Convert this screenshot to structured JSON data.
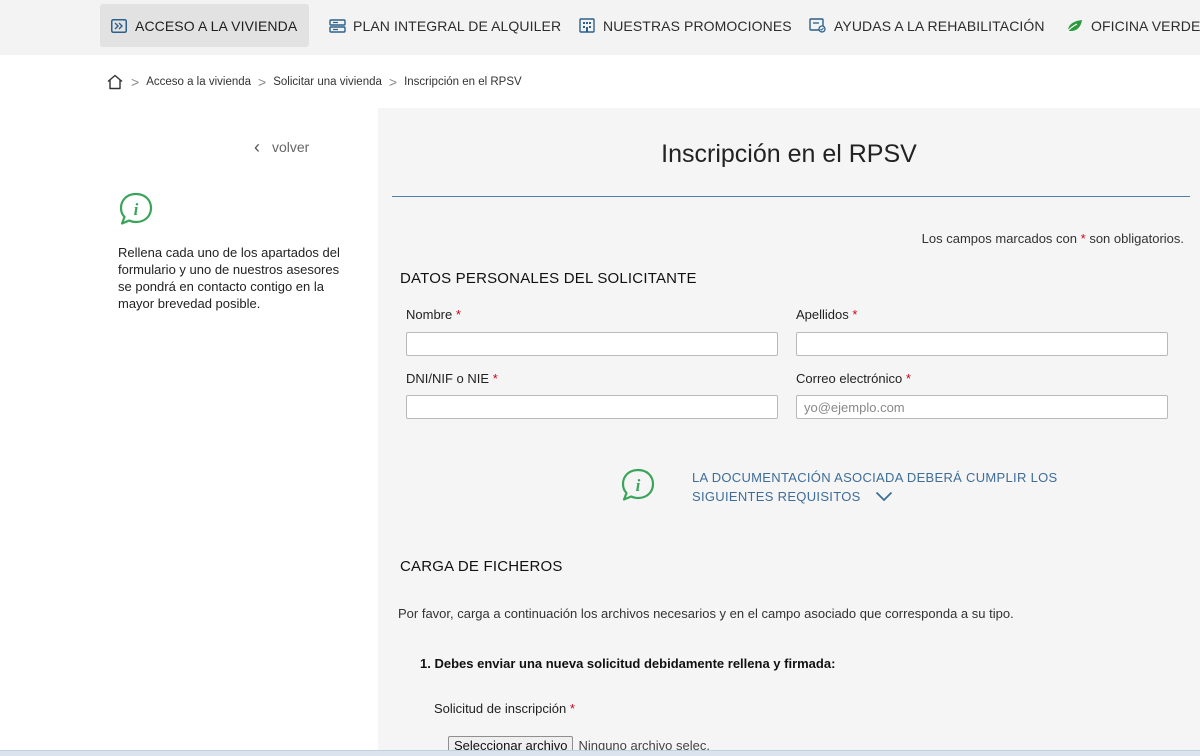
{
  "nav": {
    "items": [
      {
        "label": "ACCESO A LA VIVIENDA",
        "icon": "enter-icon"
      },
      {
        "label": "PLAN INTEGRAL DE ALQUILER",
        "icon": "cards-icon"
      },
      {
        "label": "NUESTRAS PROMOCIONES",
        "icon": "building-icon"
      },
      {
        "label": "AYUDAS A LA REHABILITACIÓN",
        "icon": "renovation-icon"
      },
      {
        "label": "OFICINA VERDE",
        "icon": "leaf-icon"
      }
    ],
    "active_index": 0
  },
  "breadcrumb": {
    "home_icon": "home-icon",
    "items": [
      "Acceso a la vivienda",
      "Solicitar una vivienda",
      "Inscripción en el RPSV"
    ]
  },
  "sidebar": {
    "back_label": "volver",
    "info_text": "Rellena cada uno de los apartados del formulario y uno de nuestros asesores se pondrá en contacto contigo en la mayor brevedad posible."
  },
  "main": {
    "title": "Inscripción en el RPSV",
    "required_note_prefix": "Los campos marcados con",
    "required_note_suffix": "son obligatorios.",
    "personal_section": "DATOS PERSONALES DEL SOLICITANTE",
    "fields": {
      "nombre": {
        "label": "Nombre",
        "value": ""
      },
      "apellidos": {
        "label": "Apellidos",
        "value": ""
      },
      "dni": {
        "label": "DNI/NIF o NIE",
        "value": ""
      },
      "email": {
        "label": "Correo electrónico",
        "placeholder": "yo@ejemplo.com",
        "value": ""
      }
    },
    "doc_info": "LA DOCUMENTACIÓN ASOCIADA DEBERÁ CUMPLIR LOS SIGUIENTES REQUISITOS",
    "files_section": "CARGA DE FICHEROS",
    "files_intro": "Por favor, carga a continuación los archivos necesarios y en el campo asociado que corresponda a su tipo.",
    "step1": "1. Debes enviar una nueva solicitud debidamente rellena y firmada:",
    "upload_label": "Solicitud de inscripción",
    "file_button": "Seleccionar archivo",
    "file_status": "Ninguno archivo selec."
  },
  "colors": {
    "accent": "#4f7ea7",
    "info_green": "#3aa55a",
    "required": "#d0021b",
    "link_blue": "#3e6d99",
    "leaf_green": "#2e9a3e"
  }
}
